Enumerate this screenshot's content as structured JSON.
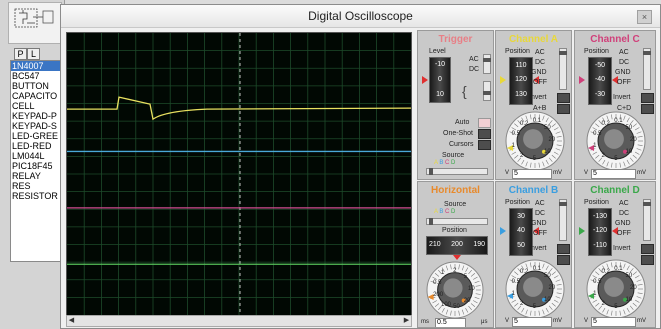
{
  "component_panel": {
    "pl_buttons": [
      "P",
      "L"
    ],
    "items": [
      "1N4007",
      "BC547",
      "BUTTON",
      "CAPACITO",
      "CELL",
      "KEYPAD-P",
      "KEYPAD-S",
      "LED-GREE",
      "LED-RED",
      "LM044L",
      "PIC18F45",
      "RELAY",
      "RES",
      "RESISTOR"
    ],
    "selected_index": 0
  },
  "window": {
    "title": "Digital Oscilloscope",
    "close_glyph": "×"
  },
  "trigger": {
    "title": "Trigger",
    "title_color": "#e87f86",
    "level_label": "Level",
    "level_values": [
      "-10",
      "0",
      "10"
    ],
    "coupling": [
      "AC",
      "DC"
    ],
    "mode": [
      "Auto",
      "One-Shot",
      "Cursors"
    ],
    "source_label": "Source",
    "source_options": [
      "A",
      "B",
      "C",
      "D"
    ]
  },
  "horizontal": {
    "title": "Horizontal",
    "title_color": "#e88a2c",
    "source_label": "Source",
    "source_options": [
      "A",
      "B",
      "C",
      "D"
    ],
    "position_label": "Position",
    "position_values": [
      "210",
      "200",
      "190"
    ],
    "dial_scale": [
      "0.5",
      "1",
      "2",
      "5",
      "10",
      "20",
      "50",
      "100",
      "200"
    ],
    "units": [
      "ms",
      "μs"
    ],
    "field_value": "0.5"
  },
  "channels": [
    {
      "title": "Channel A",
      "color": "#e8d83a",
      "position_label": "Position",
      "position_values": [
        "110",
        "120",
        "130"
      ],
      "coupling": [
        "AC",
        "DC",
        "GND",
        "OFF"
      ],
      "invert_label": "Invert",
      "extra_label": "A+B",
      "dial_scale": [
        "0.5",
        "0.2",
        "0.1",
        "50",
        "20",
        "10",
        "5",
        "2",
        "1"
      ],
      "v_label": "V",
      "mv_label": "mV",
      "field_value": "5"
    },
    {
      "title": "Channel C",
      "color": "#d0407a",
      "position_label": "Position",
      "position_values": [
        "-50",
        "-40",
        "-30"
      ],
      "coupling": [
        "AC",
        "DC",
        "GND",
        "OFF"
      ],
      "invert_label": "Invert",
      "extra_label": "C+D",
      "dial_scale": [
        "0.5",
        "0.2",
        "0.1",
        "50",
        "20",
        "10",
        "5",
        "2",
        "1"
      ],
      "v_label": "V",
      "mv_label": "mV",
      "field_value": "5"
    },
    {
      "title": "Channel B",
      "color": "#3a9ee0",
      "position_label": "Position",
      "position_values": [
        "30",
        "40",
        "50"
      ],
      "coupling": [
        "AC",
        "DC",
        "GND",
        "OFF"
      ],
      "invert_label": "Invert",
      "extra_label": "",
      "dial_scale": [
        "0.5",
        "0.2",
        "0.1",
        "50",
        "20",
        "10",
        "5",
        "2",
        "1"
      ],
      "v_label": "V",
      "mv_label": "mV",
      "field_value": "5"
    },
    {
      "title": "Channel D",
      "color": "#3aa84a",
      "position_label": "Position",
      "position_values": [
        "-130",
        "-120",
        "-110"
      ],
      "coupling": [
        "AC",
        "DC",
        "GND",
        "OFF"
      ],
      "invert_label": "Invert",
      "extra_label": "",
      "dial_scale": [
        "0.5",
        "0.2",
        "0.1",
        "50",
        "20",
        "10",
        "5",
        "2",
        "1"
      ],
      "v_label": "V",
      "mv_label": "mV",
      "field_value": "5"
    }
  ],
  "screen": {
    "background": "#010803",
    "grid_color": "#1d4a2a",
    "traces": [
      {
        "channel": "A",
        "color": "#e8e060",
        "level": 0.27
      },
      {
        "channel": "B",
        "color": "#4aa8d8",
        "level": 0.42
      },
      {
        "channel": "C",
        "color": "#d04a90",
        "level": 0.62
      },
      {
        "channel": "D",
        "color": "#56c05a",
        "level": 0.82
      }
    ]
  }
}
